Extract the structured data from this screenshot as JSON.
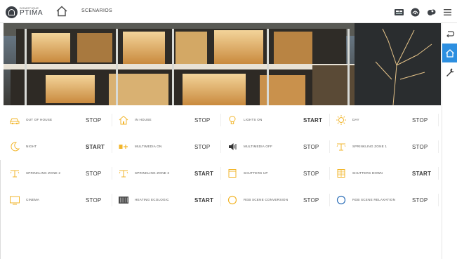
{
  "header": {
    "logo_small": "DOMOTIQUE",
    "logo_main": "PTIMA",
    "section_title": "SCENARIOS"
  },
  "top_icons": [
    "weather-widget-icon",
    "energy-icon",
    "cloud-icon",
    "menu-icon"
  ],
  "sidebar": {
    "items": [
      {
        "icon": "back-icon",
        "active": false
      },
      {
        "icon": "home-icon",
        "active": true
      },
      {
        "icon": "wrench-icon",
        "active": false
      }
    ]
  },
  "accent_color": "#2d8fe0",
  "scenarios": [
    {
      "label": "OUT OF HOUSE",
      "action": "STOP",
      "icon": "car-icon"
    },
    {
      "label": "IN HOUSE",
      "action": "STOP",
      "icon": "house-icon"
    },
    {
      "label": "LIGHTS ON",
      "action": "START",
      "icon": "bulb-icon"
    },
    {
      "label": "DAY",
      "action": "STOP",
      "icon": "sun-icon"
    },
    {
      "label": "NIGHT",
      "action": "START",
      "icon": "moon-icon"
    },
    {
      "label": "MULTIMEDIA ON",
      "action": "STOP",
      "icon": "media-on-icon"
    },
    {
      "label": "MULTIMEDIA OFF",
      "action": "STOP",
      "icon": "speaker-off-icon"
    },
    {
      "label": "SPRINKLING ZONE 1",
      "action": "STOP",
      "icon": "sprinkler-icon"
    },
    {
      "label": "SPRINKLING ZONE 2",
      "action": "STOP",
      "icon": "sprinkler-icon"
    },
    {
      "label": "SPRINKLING ZONE 3",
      "action": "START",
      "icon": "sprinkler-icon"
    },
    {
      "label": "SHUTTERS UP",
      "action": "STOP",
      "icon": "shutter-up-icon"
    },
    {
      "label": "SHUTTERS DOWN",
      "action": "START",
      "icon": "shutter-down-icon"
    },
    {
      "label": "CINEMA",
      "action": "STOP",
      "icon": "tv-icon"
    },
    {
      "label": "HEATING ECOLOGIC",
      "action": "START",
      "icon": "heating-icon"
    },
    {
      "label": "RGB SCENE CONVERSION",
      "action": "STOP",
      "icon": "rgb-ring-icon"
    },
    {
      "label": "RGB SCENE RELAXATION",
      "action": "STOP",
      "icon": "rgb-ring-blue-icon"
    }
  ]
}
